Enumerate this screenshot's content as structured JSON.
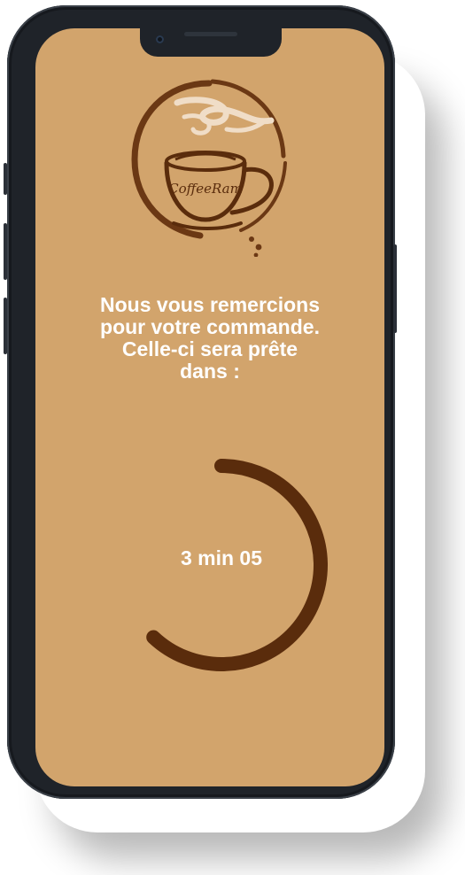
{
  "app": {
    "brand_name": "CoffeeRam"
  },
  "confirmation": {
    "line1": "Nous vous remercions",
    "line2": "pour votre commande.",
    "line3": "Celle-ci sera prête",
    "line4": "dans :"
  },
  "timer": {
    "remaining_label": "3 min 05",
    "progress_fraction": 0.62
  },
  "colors": {
    "screen_background": "#d2a46c",
    "accent_brown": "#5a2c0c",
    "text": "#ffffff",
    "logo_ring": "#6b3814",
    "logo_steam": "#f0ddc7"
  },
  "icons": {
    "logo": "coffee-cup-logo-icon"
  }
}
